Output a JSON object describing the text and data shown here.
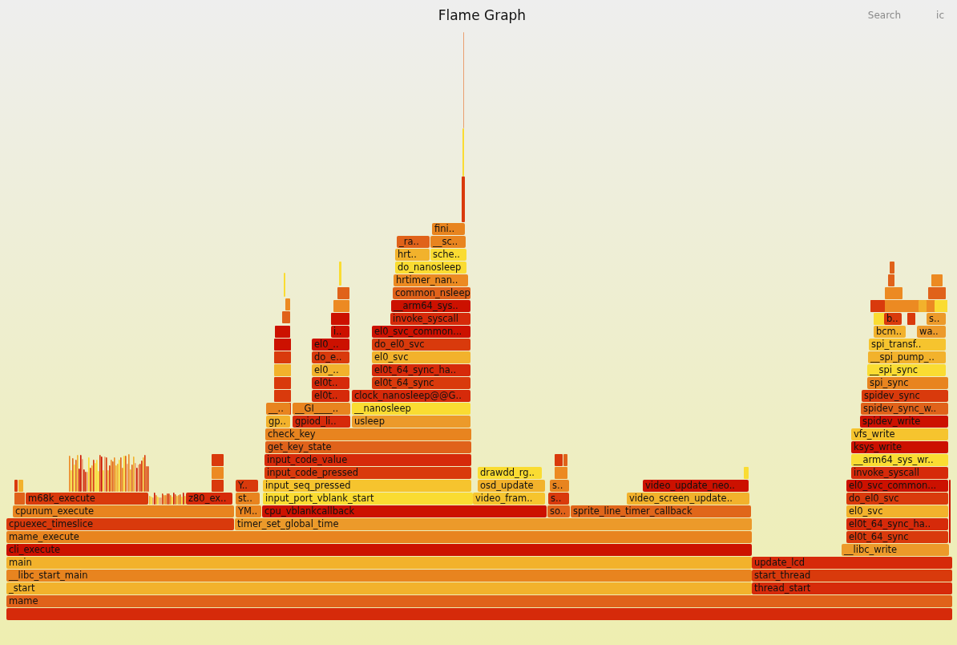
{
  "header": {
    "title": "Flame Graph",
    "search": "Search",
    "ic": "ic"
  },
  "frames": [
    {
      "name": "fini..",
      "color": "#e8841f"
    },
    {
      "name": "_ra..",
      "color": "#e0621a"
    },
    {
      "name": "__sc..",
      "color": "#e8841f"
    },
    {
      "name": "hrt..",
      "color": "#f2b22c"
    },
    {
      "name": "sche..",
      "color": "#fadc32"
    },
    {
      "name": "do_nanosleep",
      "color": "#fadc32"
    },
    {
      "name": "hrtimer_nan..",
      "color": "#ec8a22"
    },
    {
      "name": "common_nsleep",
      "color": "#e0621a"
    },
    {
      "name": "__arm64_sys..",
      "color": "#cc1100"
    },
    {
      "name": "invoke_syscall",
      "color": "#d62a0a"
    },
    {
      "name": "b..",
      "color": "#d93a0c"
    },
    {
      "name": "s..",
      "color": "#ec9a2a"
    },
    {
      "name": "i..",
      "color": "#cc1100"
    },
    {
      "name": "el0_svc_common...",
      "color": "#cc1100"
    },
    {
      "name": "bcm..",
      "color": "#f2b22c"
    },
    {
      "name": "wa..",
      "color": "#ec9a2a"
    },
    {
      "name": "el0_..",
      "color": "#cc1100"
    },
    {
      "name": "do_el0_svc",
      "color": "#d93a0c"
    },
    {
      "name": "spi_transf..",
      "color": "#f6c42e"
    },
    {
      "name": "do_e..",
      "color": "#d93a0c"
    },
    {
      "name": "el0_svc",
      "color": "#f2b22c"
    },
    {
      "name": "__spi_pump_..",
      "color": "#f2b22c"
    },
    {
      "name": "el0_..",
      "color": "#f2b22c"
    },
    {
      "name": "el0t_64_sync_ha..",
      "color": "#d62a0a"
    },
    {
      "name": "__spi_sync",
      "color": "#fadc32"
    },
    {
      "name": "el0t..",
      "color": "#d62a0a"
    },
    {
      "name": "el0t_64_sync",
      "color": "#d93a0c"
    },
    {
      "name": "spi_sync",
      "color": "#e8841f"
    },
    {
      "name": "el0t..",
      "color": "#d62a0a"
    },
    {
      "name": "clock_nanosleep@@G..",
      "color": "#d62a0a"
    },
    {
      "name": "spidev_sync",
      "color": "#d93a0c"
    },
    {
      "name": "__..",
      "color": "#e8841f"
    },
    {
      "name": "__GI____..",
      "color": "#e8841f"
    },
    {
      "name": "__nanosleep",
      "color": "#fadc32"
    },
    {
      "name": "spidev_sync_w..",
      "color": "#e0621a"
    },
    {
      "name": "gp..",
      "color": "#f2b22c"
    },
    {
      "name": "gpiod_li..",
      "color": "#d62a0a"
    },
    {
      "name": "usleep",
      "color": "#ec9a2a"
    },
    {
      "name": "spidev_write",
      "color": "#cc1100"
    },
    {
      "name": "check_key",
      "color": "#e8841f"
    },
    {
      "name": "vfs_write",
      "color": "#f6c42e"
    },
    {
      "name": "get_key_state",
      "color": "#e0621a"
    },
    {
      "name": "ksys_write",
      "color": "#cc1100"
    },
    {
      "name": "input_code_value",
      "color": "#d62a0a"
    },
    {
      "name": "__arm64_sys_wr..",
      "color": "#fadc32"
    },
    {
      "name": "input_code_pressed",
      "color": "#d93a0c"
    },
    {
      "name": "drawdd_rg..",
      "color": "#fadc32"
    },
    {
      "name": "invoke_syscall",
      "color": "#d62a0a"
    },
    {
      "name": "Y..",
      "color": "#d93a0c"
    },
    {
      "name": "input_seq_pressed",
      "color": "#f6c42e"
    },
    {
      "name": "osd_update",
      "color": "#f2b22c"
    },
    {
      "name": "s..",
      "color": "#e8841f"
    },
    {
      "name": "video_update_neo..",
      "color": "#cc1100"
    },
    {
      "name": "el0_svc_common...",
      "color": "#cc1100"
    },
    {
      "name": "m68k_execute",
      "color": "#d93a0c"
    },
    {
      "name": "z80_ex..",
      "color": "#d62a0a"
    },
    {
      "name": "st..",
      "color": "#e8841f"
    },
    {
      "name": "input_port_vblank_start",
      "color": "#fadc32"
    },
    {
      "name": "video_fram..",
      "color": "#f6c42e"
    },
    {
      "name": "s..",
      "color": "#d93a0c"
    },
    {
      "name": "video_screen_update..",
      "color": "#f2b22c"
    },
    {
      "name": "do_el0_svc",
      "color": "#d93a0c"
    },
    {
      "name": "cpunum_execute",
      "color": "#e8841f"
    },
    {
      "name": "YM..",
      "color": "#e8841f"
    },
    {
      "name": "cpu_vblankcallback",
      "color": "#cc1100"
    },
    {
      "name": "so..",
      "color": "#e0621a"
    },
    {
      "name": "sprite_line_timer_callback",
      "color": "#e0661a"
    },
    {
      "name": "el0_svc",
      "color": "#f2b22c"
    },
    {
      "name": "cpuexec_timeslice",
      "color": "#d93a0c"
    },
    {
      "name": "timer_set_global_time",
      "color": "#ec9a2a"
    },
    {
      "name": "el0t_64_sync_ha..",
      "color": "#d62a0a"
    },
    {
      "name": "mame_execute",
      "color": "#e8841f"
    },
    {
      "name": "el0t_64_sync",
      "color": "#d93a0c"
    },
    {
      "name": "cli_execute",
      "color": "#cc1100"
    },
    {
      "name": "__libc_write",
      "color": "#ec9a2a"
    },
    {
      "name": "main",
      "color": "#f2b22c"
    },
    {
      "name": "update_lcd",
      "color": "#d62a0a"
    },
    {
      "name": "__libc_start_main",
      "color": "#e8841f"
    },
    {
      "name": "start_thread",
      "color": "#d93a0c"
    },
    {
      "name": "_start",
      "color": "#f2b22c"
    },
    {
      "name": "thread_start",
      "color": "#d62a0a"
    },
    {
      "name": "mame",
      "color": "#e0621a"
    },
    {
      "color": "#d62a0a"
    }
  ]
}
